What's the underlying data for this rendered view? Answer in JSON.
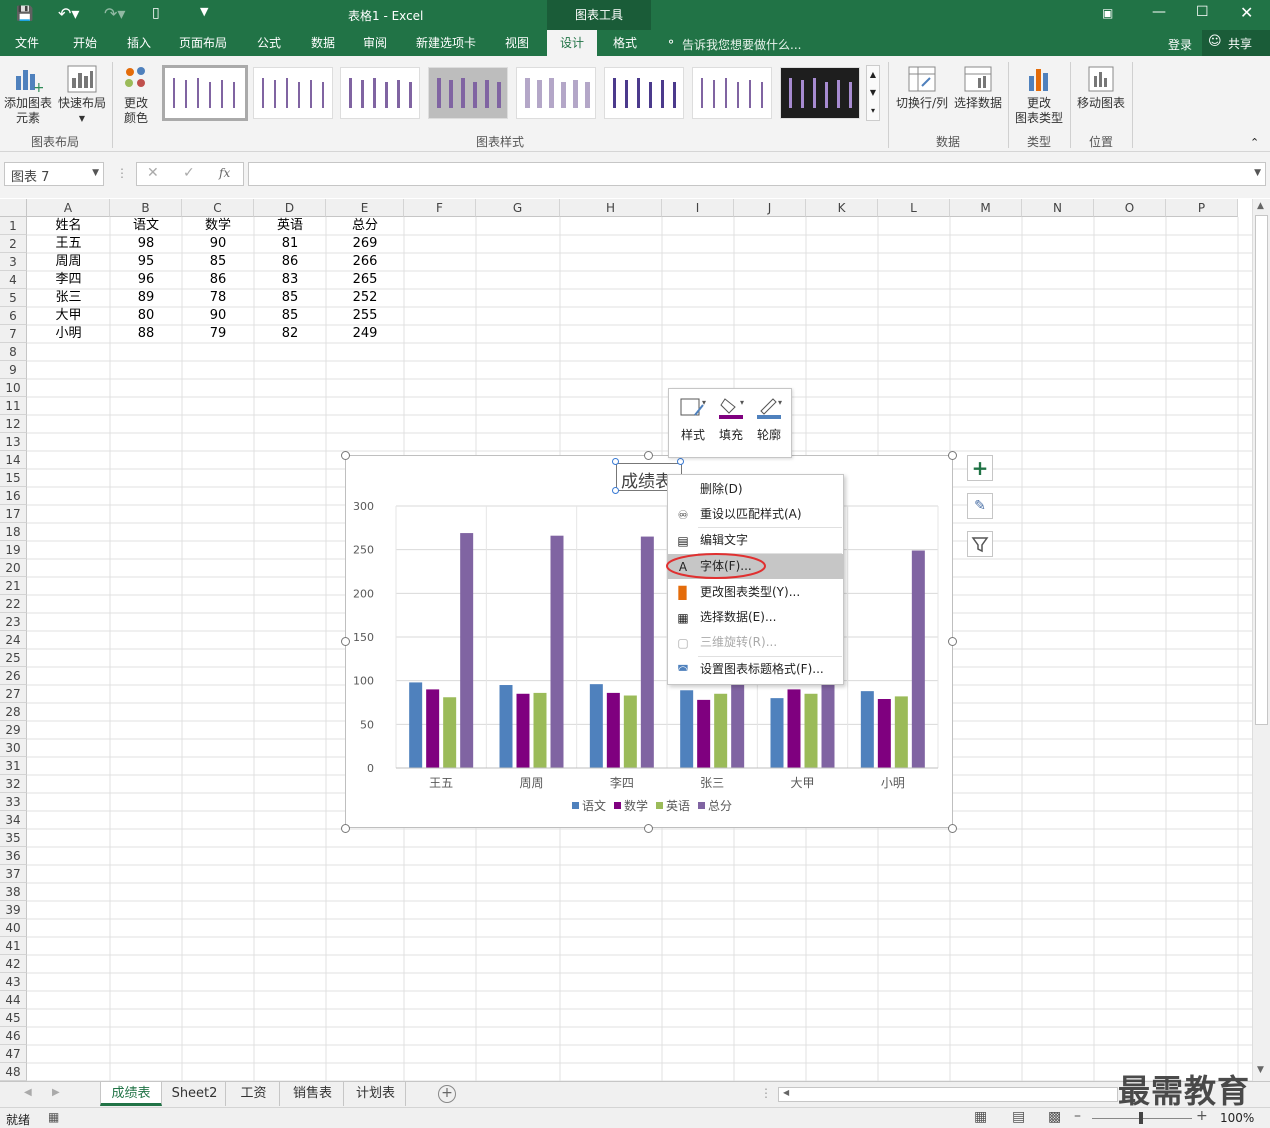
{
  "window": {
    "title": "表格1 - Excel",
    "context_tab_group": "图表工具"
  },
  "tabs": [
    "文件",
    "开始",
    "插入",
    "页面布局",
    "公式",
    "数据",
    "审阅",
    "新建选项卡",
    "视图",
    "设计",
    "格式"
  ],
  "active_tab": "设计",
  "tell_me": "告诉我您想要做什么...",
  "account": {
    "login": "登录",
    "share": "共享"
  },
  "ribbon": {
    "add_element": "添加图表\n元素",
    "quick_layout": "快速布局",
    "change_color": "更改\n颜色",
    "group_layout": "图表布局",
    "group_styles": "图表样式",
    "switch_row_col": "切换行/列",
    "select_data": "选择数据",
    "group_data": "数据",
    "change_type": "更改\n图表类型",
    "group_type": "类型",
    "move_chart": "移动图表",
    "group_location": "位置"
  },
  "formula_bar": {
    "name_box": "图表 7",
    "fx": "fx",
    "value": ""
  },
  "columns": [
    "A",
    "B",
    "C",
    "D",
    "E",
    "F",
    "G",
    "H",
    "I",
    "J",
    "K",
    "L",
    "M",
    "N",
    "O",
    "P"
  ],
  "rows": [
    "1",
    "2",
    "3",
    "4",
    "5",
    "6",
    "7",
    "8",
    "9",
    "10",
    "11",
    "12",
    "13",
    "14",
    "15",
    "16",
    "17",
    "18",
    "19",
    "20",
    "21",
    "22",
    "23",
    "24",
    "25",
    "26",
    "27",
    "28",
    "29",
    "30",
    "31",
    "32",
    "33",
    "34",
    "35",
    "36",
    "37",
    "38",
    "39",
    "40",
    "41",
    "42",
    "43",
    "44",
    "45",
    "46",
    "47",
    "48"
  ],
  "table": {
    "header": [
      "姓名",
      "语文",
      "数学",
      "英语",
      "总分"
    ],
    "data": [
      [
        "王五",
        "98",
        "90",
        "81",
        "269"
      ],
      [
        "周周",
        "95",
        "85",
        "86",
        "266"
      ],
      [
        "李四",
        "96",
        "86",
        "83",
        "265"
      ],
      [
        "张三",
        "89",
        "78",
        "85",
        "252"
      ],
      [
        "大甲",
        "80",
        "90",
        "85",
        "255"
      ],
      [
        "小明",
        "88",
        "79",
        "82",
        "249"
      ]
    ]
  },
  "float_toolbar": {
    "style": "样式",
    "fill": "填充",
    "outline": "轮廓"
  },
  "chart_data": {
    "type": "bar",
    "title": "成绩表",
    "categories": [
      "王五",
      "周周",
      "李四",
      "张三",
      "大甲",
      "小明"
    ],
    "series": [
      {
        "name": "语文",
        "values": [
          98,
          95,
          96,
          89,
          80,
          88
        ],
        "color": "#4f81bd"
      },
      {
        "name": "数学",
        "values": [
          90,
          85,
          86,
          78,
          90,
          79
        ],
        "color": "#7f007f"
      },
      {
        "name": "英语",
        "values": [
          81,
          86,
          83,
          85,
          85,
          82
        ],
        "color": "#9bbb59"
      },
      {
        "name": "总分",
        "values": [
          269,
          266,
          265,
          252,
          255,
          249
        ],
        "color": "#8064a2"
      }
    ],
    "yticks": [
      "0",
      "50",
      "100",
      "150",
      "200",
      "250",
      "300"
    ],
    "ylim": [
      0,
      300
    ],
    "legend": "bottom"
  },
  "context_menu": [
    {
      "label": "删除(D)",
      "icon": "",
      "enabled": true
    },
    {
      "label": "重设以匹配样式(A)",
      "icon": "reset-icon",
      "enabled": true
    },
    {
      "label": "编辑文字",
      "icon": "edit-text-icon",
      "enabled": true
    },
    {
      "label": "字体(F)...",
      "icon": "font-icon",
      "enabled": true
    },
    {
      "label": "更改图表类型(Y)...",
      "icon": "chart-type-icon",
      "enabled": true
    },
    {
      "label": "选择数据(E)...",
      "icon": "select-data-icon",
      "enabled": true
    },
    {
      "label": "三维旋转(R)...",
      "icon": "rotate-3d-icon",
      "enabled": false
    },
    {
      "label": "设置图表标题格式(F)...",
      "icon": "format-icon",
      "enabled": true
    }
  ],
  "sheet_tabs": [
    "成绩表",
    "Sheet2",
    "工资",
    "销售表",
    "计划表"
  ],
  "active_sheet": "成绩表",
  "status": {
    "ready": "就绪",
    "zoom": "100%"
  },
  "watermark": "最需教育",
  "colors": {
    "excel_green": "#217346",
    "highlight_red": "#e03030"
  }
}
